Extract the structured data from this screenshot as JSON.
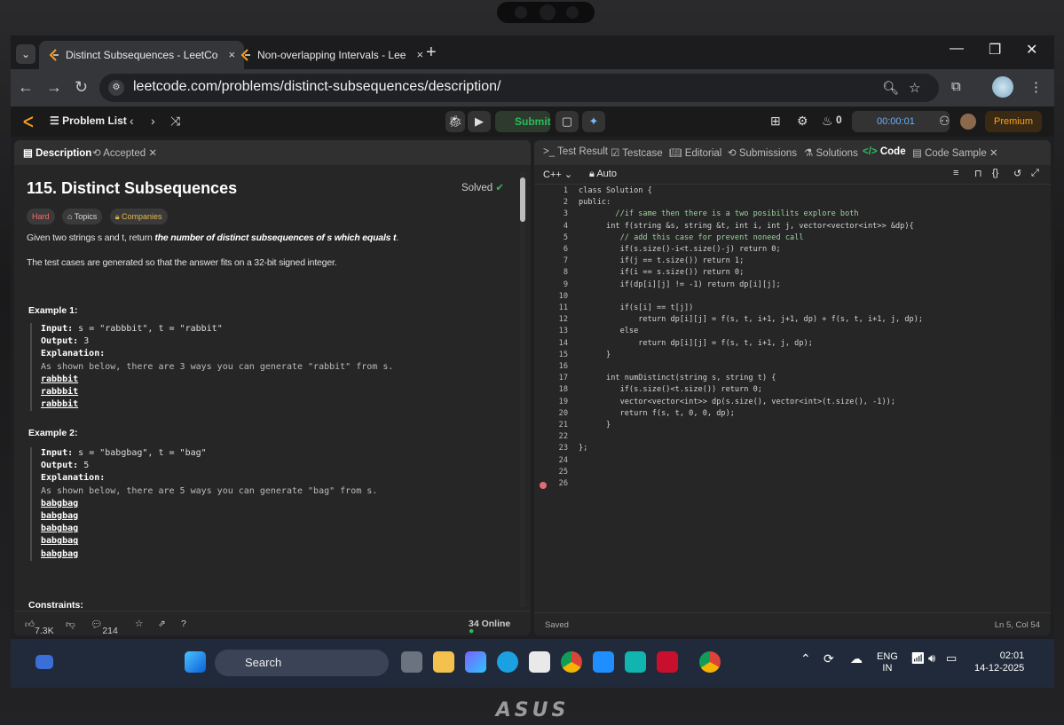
{
  "browser": {
    "tabs": [
      {
        "title": "Distinct Subsequences - LeetCo",
        "close": "×"
      },
      {
        "title": "Non-overlapping Intervals - Lee",
        "close": "×"
      }
    ],
    "new_tab": "+",
    "url": "leetcode.com/problems/distinct-subsequences/description/",
    "window_controls": [
      "—",
      "❐",
      "✕"
    ]
  },
  "lc_header": {
    "problem_list": "Problem List",
    "submit": "Submit",
    "streak": "0",
    "timer": "00:00:01",
    "premium": "Premium"
  },
  "left_panel": {
    "tabs": {
      "description": "Description",
      "accepted": "Accepted"
    },
    "title": "115. Distinct Subsequences",
    "solved": "Solved",
    "tags": {
      "difficulty": "Hard",
      "topics": "Topics",
      "companies": "Companies"
    },
    "statement_pre": "Given two strings s and t, return ",
    "statement_em": "the number of distinct subsequences of s which equals t",
    "statement_post": ".",
    "note": "The test cases are generated so that the answer fits on a 32-bit signed integer.",
    "example1": {
      "heading": "Example 1:",
      "input_label": "Input:",
      "input": "s = \"rabbbit\", t = \"rabbit\"",
      "output_label": "Output:",
      "output": "3",
      "expl_label": "Explanation:",
      "expl": "As shown below, there are 3 ways you can generate \"rabbit\" from s.",
      "ways": [
        "rabbbit",
        "rabbbit",
        "rabbbit"
      ]
    },
    "example2": {
      "heading": "Example 2:",
      "input_label": "Input:",
      "input": "s = \"babgbag\", t = \"bag\"",
      "output_label": "Output:",
      "output": "5",
      "expl_label": "Explanation:",
      "expl": "As shown below, there are 5 ways you can generate \"bag\" from s.",
      "ways": [
        "babgbag",
        "babgbag",
        "babgbag",
        "babgbag",
        "babgbag"
      ]
    },
    "constraints": "Constraints:",
    "footer": {
      "likes": "7.3K",
      "comments": "214",
      "online": "34 Online"
    }
  },
  "right_panel": {
    "tabs": [
      "Test Result",
      "Testcase",
      "Editorial",
      "Submissions",
      "Solutions",
      "Code",
      "Code Sample"
    ],
    "language": "C++",
    "auto": "Auto",
    "status": "Saved",
    "cursor": "Ln 5, Col 54",
    "code_lines": [
      "class Solution {",
      "public:",
      "        //if same then there is a two posibilits explore both",
      "      int f(string &s, string &t, int i, int j, vector<vector<int>> &dp){",
      "         // add this case for prevent noneed call",
      "         if(s.size()-i<t.size()-j) return 0;",
      "         if(j == t.size()) return 1;",
      "         if(i == s.size()) return 0;",
      "         if(dp[i][j] != -1) return dp[i][j];",
      "",
      "         if(s[i] == t[j])",
      "             return dp[i][j] = f(s, t, i+1, j+1, dp) + f(s, t, i+1, j, dp);",
      "         else",
      "             return dp[i][j] = f(s, t, i+1, j, dp);",
      "      }",
      "",
      "      int numDistinct(string s, string t) {",
      "         if(s.size()<t.size()) return 0;",
      "         vector<vector<int>> dp(s.size(), vector<int>(t.size(), -1));",
      "         return f(s, t, 0, 0, dp);",
      "      }",
      "",
      "};",
      "",
      "",
      ""
    ]
  },
  "taskbar": {
    "search": "Search",
    "lang": "ENG",
    "region": "IN",
    "time": "02:01",
    "date": "14-12-2025"
  },
  "device_brand": "ASUS"
}
